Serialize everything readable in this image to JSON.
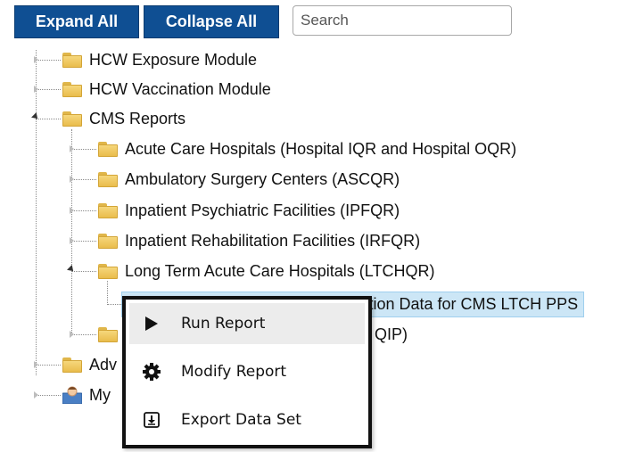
{
  "toolbar": {
    "expand_label": "Expand All",
    "collapse_label": "Collapse All",
    "search_placeholder": "Search"
  },
  "tree": {
    "hcw_exposure": "HCW Exposure Module",
    "hcw_vaccination": "HCW Vaccination Module",
    "cms_reports": "CMS Reports",
    "acute_care": "Acute Care Hospitals (Hospital IQR and Hospital OQR)",
    "ambulatory": "Ambulatory Surgery Centers (ASCQR)",
    "inpatient_psych": "Inpatient Psychiatric Facilities (IPFQR)",
    "inpatient_rehab": "Inpatient Rehabilitation Facilities (IRFQR)",
    "ltch": "Long Term Acute Care Hospitals (LTCHQR)",
    "line_listing": "Line Listing - HCP Flu Vaccination Data for CMS LTCH PPS",
    "partial_hidden": "QIP)",
    "advanced_partial": "Adv",
    "my_partial": "My"
  },
  "context_menu": {
    "items": [
      {
        "label": "Run Report",
        "icon": "play-icon"
      },
      {
        "label": "Modify Report",
        "icon": "gear-icon"
      },
      {
        "label": "Export Data Set",
        "icon": "export-icon"
      }
    ]
  },
  "colors": {
    "button_bg": "#0f4f93",
    "selected_bg": "#cce6f6",
    "folder": "#f6d77c"
  }
}
